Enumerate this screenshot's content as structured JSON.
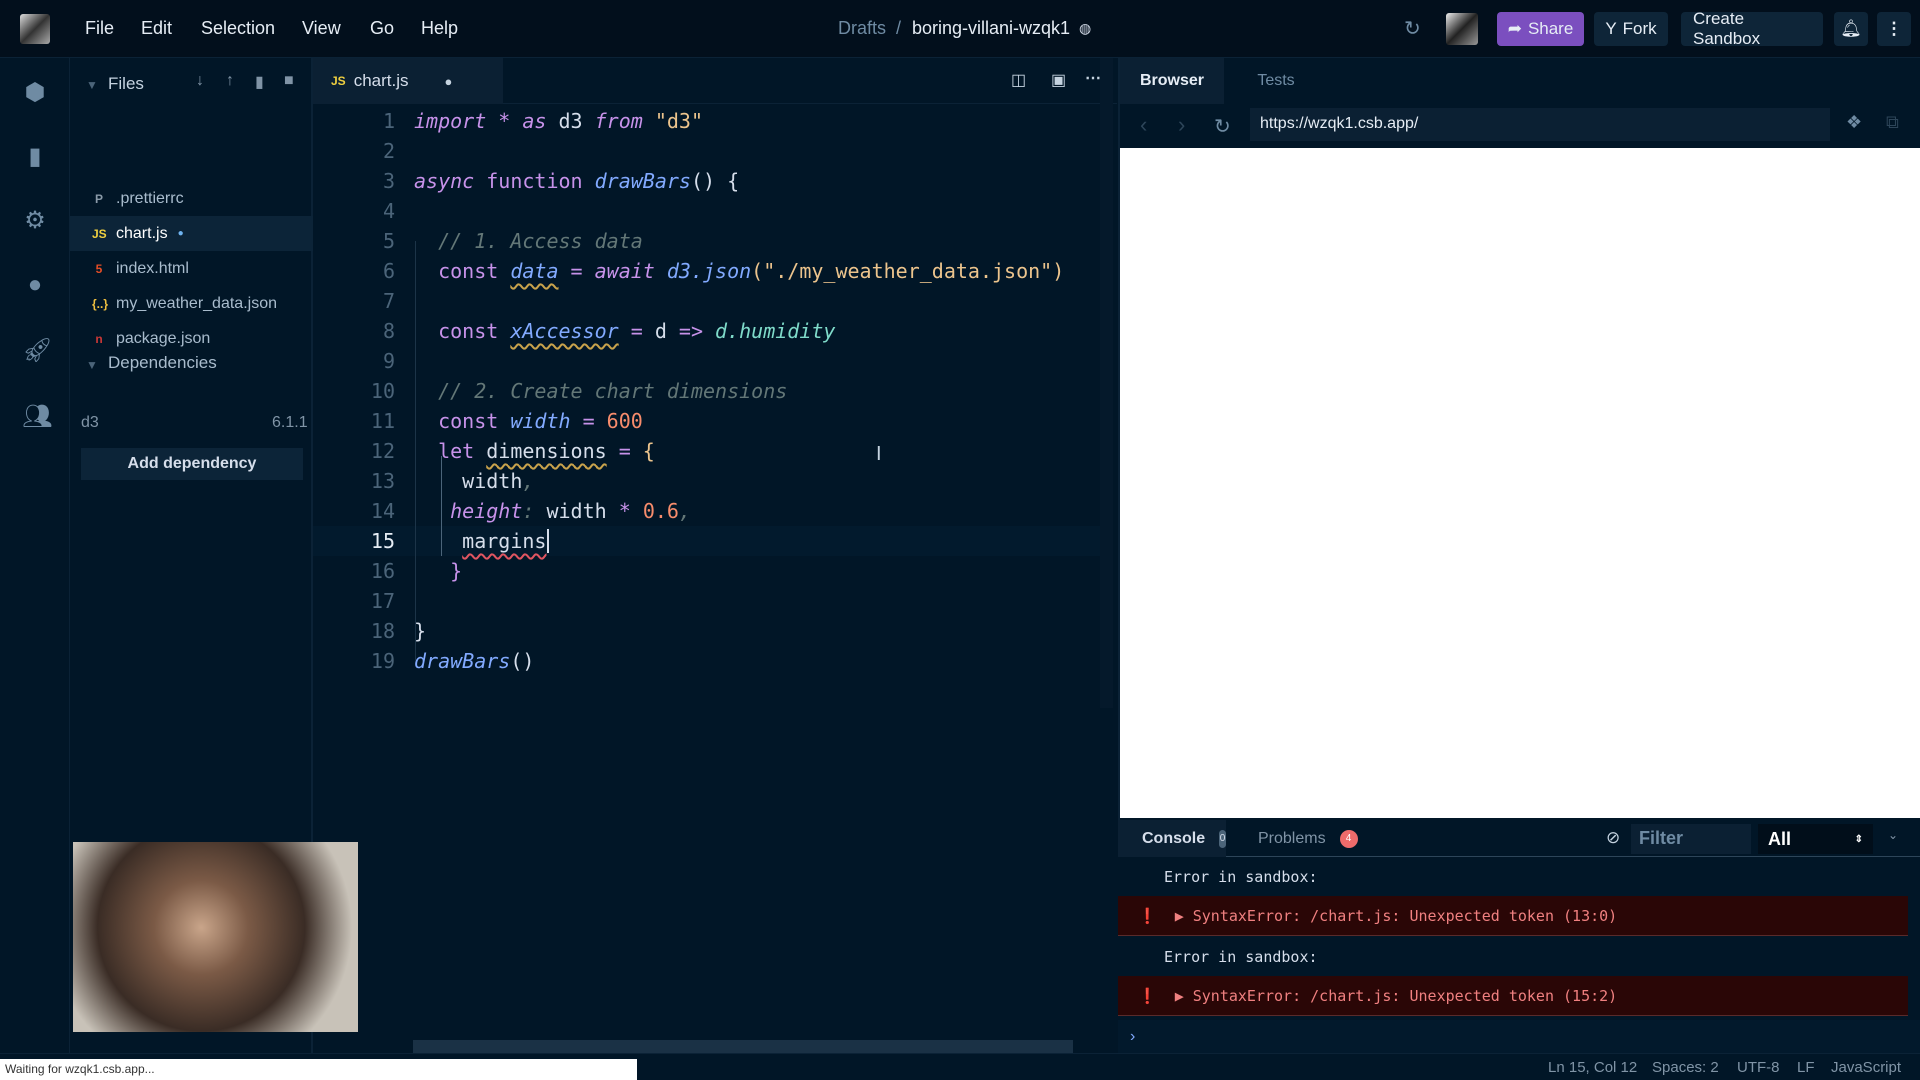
{
  "menu": [
    "File",
    "Edit",
    "Selection",
    "View",
    "Go",
    "Help"
  ],
  "breadcrumb": {
    "drafts": "Drafts",
    "sep": "/",
    "sandbox": "boring-villani-wzqk1"
  },
  "header": {
    "share": "Share",
    "fork": "Fork",
    "create": "Create Sandbox"
  },
  "files": {
    "title": "Files",
    "items": [
      {
        "name": ".prettierrc",
        "icon": "P",
        "color": "#8a9aa8"
      },
      {
        "name": "chart.js",
        "icon": "JS",
        "color": "#f0d040"
      },
      {
        "name": "index.html",
        "icon": "5",
        "color": "#e44d26"
      },
      {
        "name": "my_weather_data.json",
        "icon": "{..}",
        "color": "#f0c040"
      },
      {
        "name": "package.json",
        "icon": "n",
        "color": "#cb3837"
      }
    ]
  },
  "dependencies": {
    "title": "Dependencies",
    "items": [
      {
        "name": "d3",
        "version": "6.1.1"
      }
    ],
    "add": "Add dependency"
  },
  "editor": {
    "tab": "chart.js",
    "tab_icon": "JS",
    "lines": [
      [
        [
          "import",
          "k"
        ],
        [
          " * ",
          "p"
        ],
        [
          "as",
          "k"
        ],
        [
          " d3 ",
          "v"
        ],
        [
          "from",
          "k"
        ],
        [
          " \"d3\"",
          "s"
        ]
      ],
      [],
      [
        [
          "async",
          "k"
        ],
        [
          " ",
          "v"
        ],
        [
          "function",
          "kw"
        ],
        [
          " drawBars",
          "f"
        ],
        [
          "() {",
          "v"
        ]
      ],
      [],
      [
        [
          "  // 1. Access data",
          "c"
        ]
      ],
      [
        [
          "  const ",
          "kw"
        ],
        [
          "data",
          "vi sq"
        ],
        [
          " = ",
          "p"
        ],
        [
          "await",
          "k"
        ],
        [
          " d3.json",
          "f"
        ],
        [
          "(\"./my_weather_data.json\")",
          "s"
        ]
      ],
      [],
      [
        [
          "  const ",
          "kw"
        ],
        [
          "xAccessor",
          "vi sq"
        ],
        [
          " = ",
          "p"
        ],
        [
          "d",
          "v"
        ],
        [
          " => ",
          "p"
        ],
        [
          "d.humidity",
          "t"
        ]
      ],
      [],
      [
        [
          "  // 2. Create chart dimensions",
          "c"
        ]
      ],
      [
        [
          "  const ",
          "kw"
        ],
        [
          "width",
          "vi"
        ],
        [
          " = ",
          "p"
        ],
        [
          "600",
          "n"
        ]
      ],
      [
        [
          "  let ",
          "kw"
        ],
        [
          "dimensions",
          "v sq"
        ],
        [
          " = ",
          "p"
        ],
        [
          "{",
          "s"
        ]
      ],
      [
        [
          "    width",
          "v"
        ],
        [
          ",",
          "c"
        ]
      ],
      [
        [
          "   height",
          "h"
        ],
        [
          ": ",
          "c"
        ],
        [
          "width",
          "v"
        ],
        [
          " * ",
          "p"
        ],
        [
          "0.6",
          "n"
        ],
        [
          ",",
          "c"
        ]
      ],
      [
        [
          "    ",
          "v"
        ],
        [
          "margins",
          "v sqr"
        ]
      ],
      [
        [
          "   }",
          "p"
        ]
      ],
      [],
      [
        [
          "}",
          "v"
        ]
      ],
      [
        [
          "drawBars",
          "f"
        ],
        [
          "()",
          "v"
        ]
      ]
    ],
    "current_line": 15
  },
  "preview": {
    "tabs": [
      "Browser",
      "Tests"
    ],
    "url": "https://wzqk1.csb.app/"
  },
  "console": {
    "tab": "Console",
    "count": "0",
    "problems": "Problems",
    "problems_count": "4",
    "filter_placeholder": "Filter",
    "level": "All",
    "entries": [
      {
        "msg": "Error in sandbox:",
        "error": "SyntaxError: /chart.js: Unexpected token (13:0)"
      },
      {
        "msg": "Error in sandbox:",
        "error": "SyntaxError: /chart.js: Unexpected token (15:2)"
      }
    ],
    "prompt": "›"
  },
  "status": {
    "loading": "Waiting for wzqk1.csb.app...",
    "position": "Ln 15, Col 12",
    "spaces": "Spaces: 2",
    "encoding": "UTF-8",
    "eol": "LF",
    "language": "JavaScript"
  }
}
